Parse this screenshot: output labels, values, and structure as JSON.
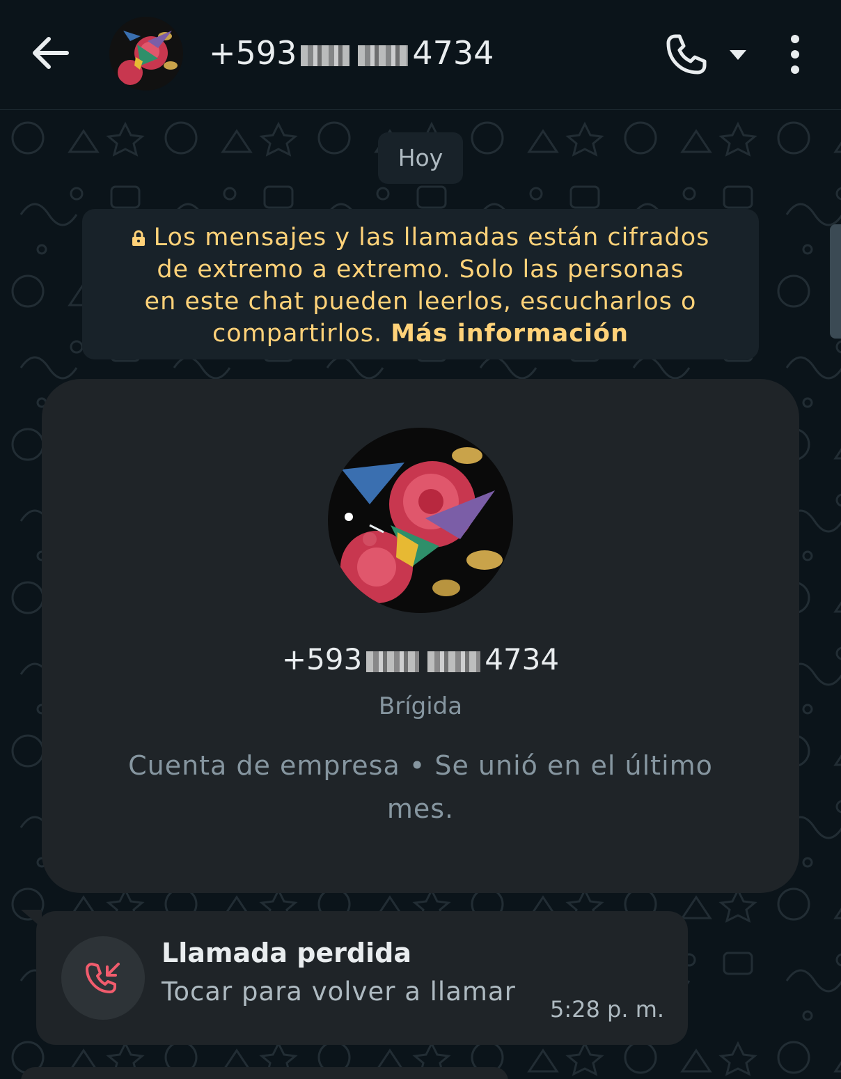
{
  "header": {
    "phone_prefix": "+593",
    "phone_suffix": "4734"
  },
  "chat": {
    "date_chip": "Hoy",
    "encryption_notice": {
      "text_line1": "Los mensajes y las llamadas están cifrados",
      "text_line2": "de extremo a extremo. Solo las personas",
      "text_line3": "en este chat pueden leerlos, escucharlos o",
      "text_line4": "compartirlos.",
      "link": "Más información"
    },
    "profile_card": {
      "phone_prefix": "+593",
      "phone_suffix": "4734",
      "name": "Brígida",
      "meta_line1": "Cuenta de empresa • Se unió en el último",
      "meta_line2": "mes."
    },
    "missed_call": {
      "title": "Llamada perdida",
      "subtitle": "Tocar para volver a llamar",
      "time": "5:28 p. m."
    }
  },
  "colors": {
    "background": "#0b141a",
    "bubble": "#1f2428",
    "encryption_text": "#ffd279",
    "missed_call_red": "#f15c6d"
  },
  "icons": {
    "back": "arrow-left-icon",
    "call": "phone-icon",
    "caret": "caret-down-icon",
    "menu": "more-vert-icon",
    "lock": "lock-icon",
    "missed_call": "missed-call-icon"
  }
}
